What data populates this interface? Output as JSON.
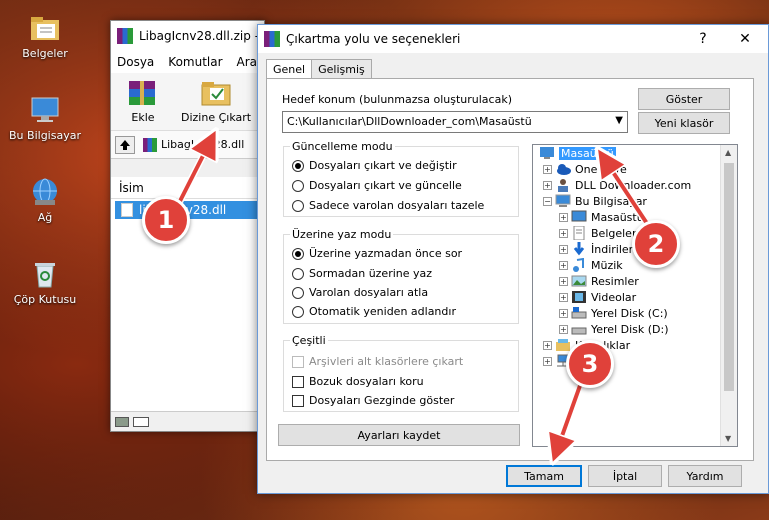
{
  "desktop": {
    "icons": [
      {
        "label": "Belgeler",
        "icon": "documents-folder-icon"
      },
      {
        "label": "Bu Bilgisayar",
        "icon": "computer-icon"
      },
      {
        "label": "Ağ",
        "icon": "network-icon"
      },
      {
        "label": "Çöp Kutusu",
        "icon": "recycle-bin-icon"
      }
    ]
  },
  "rar": {
    "title": "LibagIcnv28.dll.zip -",
    "menu": [
      "Dosya",
      "Komutlar",
      "Araçla"
    ],
    "tools": {
      "add": "Ekle",
      "extract_to": "Dizine Çıkart"
    },
    "address": "LibagIcnv28.dll",
    "list_header": "İsim",
    "file": "libaglcnv28.dll"
  },
  "dialog": {
    "title": "Çıkartma yolu ve seçenekleri",
    "tabs": [
      "Genel",
      "Gelişmiş"
    ],
    "target_label": "Hedef konum (bulunmazsa oluşturulacak)",
    "target_value": "C:\\Kullanıcılar\\DllDownloader_com\\Masaüstü",
    "show_button": "Göster",
    "new_folder_button": "Yeni klasör",
    "update_group": {
      "title": "Güncelleme modu",
      "options": [
        "Dosyaları çıkart ve değiştir",
        "Dosyaları çıkart ve güncelle",
        "Sadece varolan dosyaları tazele"
      ],
      "selected": 0
    },
    "overwrite_group": {
      "title": "Üzerine yaz modu",
      "options": [
        "Üzerine yazmadan önce sor",
        "Sormadan üzerine yaz",
        "Varolan dosyaları atla",
        "Otomatik yeniden adlandır"
      ],
      "selected": 0
    },
    "misc_group": {
      "title": "Çeşitli",
      "options": [
        "Arşivleri alt klasörlere çıkart",
        "Bozuk dosyaları koru",
        "Dosyaları Gezginde göster"
      ]
    },
    "save_settings": "Ayarları kaydet",
    "tree": [
      {
        "label": "Masaüstü",
        "icon": "desktop-icon"
      },
      {
        "label": "OneDrive",
        "icon": "onedrive-cloud-icon"
      },
      {
        "label": "DLL Downloader.com",
        "icon": "user-icon"
      },
      {
        "label": "Bu Bilgisayar",
        "icon": "computer-icon"
      },
      {
        "label": "Masaüstü",
        "icon": "desktop-icon"
      },
      {
        "label": "Belgeler",
        "icon": "documents-icon"
      },
      {
        "label": "İndirilenler",
        "icon": "download-icon"
      },
      {
        "label": "Müzik",
        "icon": "music-icon"
      },
      {
        "label": "Resimler",
        "icon": "pictures-icon"
      },
      {
        "label": "Videolar",
        "icon": "videos-icon"
      },
      {
        "label": "Yerel Disk (C:)",
        "icon": "drive-icon"
      },
      {
        "label": "Yerel Disk (D:)",
        "icon": "drive-icon"
      },
      {
        "label": "Kitaplıklar",
        "icon": "library-icon"
      },
      {
        "label": "",
        "icon": "network-icon"
      }
    ],
    "ok": "Tamam",
    "cancel": "İptal",
    "help": "Yardım"
  },
  "annotations": [
    "1",
    "2",
    "3"
  ],
  "colors": {
    "badge": "#e0413a",
    "selection": "#3399ff",
    "focus": "#0078d7"
  }
}
